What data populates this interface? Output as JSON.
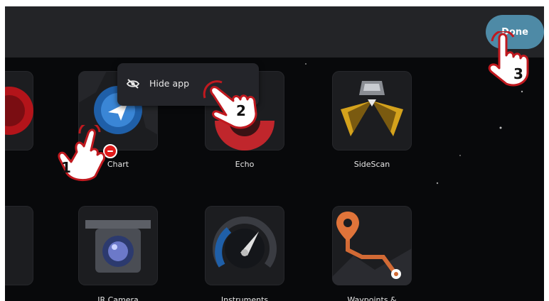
{
  "topbar": {
    "done_label": "Done"
  },
  "context_menu": {
    "hide_label": "Hide app",
    "icon": "eye-off-icon"
  },
  "apps": [
    {
      "label": "Chart",
      "icon": "compass-navigation-icon"
    },
    {
      "label": "Echo",
      "icon": "echo-sonar-icon"
    },
    {
      "label": "SideScan",
      "icon": "sidescan-boat-icon"
    },
    {
      "label": "IR Camera",
      "icon": "ir-camera-icon"
    },
    {
      "label": "Instruments",
      "icon": "gauge-icon"
    },
    {
      "label": "Waypoints &",
      "icon": "waypoint-route-icon"
    }
  ],
  "steps": [
    "1",
    "2",
    "3"
  ],
  "colors": {
    "accent": "#4e8aa6",
    "remove": "#e01a1a",
    "hand_outline": "#c0191f"
  }
}
